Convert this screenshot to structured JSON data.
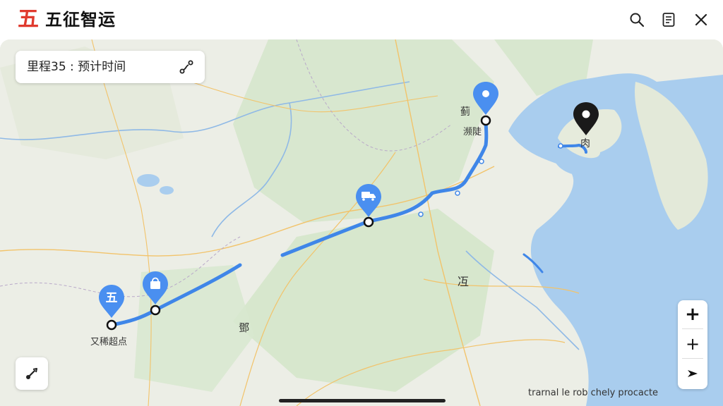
{
  "app": {
    "logo_char": "五",
    "title": "五征智运"
  },
  "header": {
    "icons": [
      "search-icon",
      "document-icon",
      "close-icon"
    ]
  },
  "info_card": {
    "text": "里程35 : 预计时间",
    "icon": "route-icon"
  },
  "map": {
    "labels": {
      "origin": "又稀超点",
      "top_city_a": "蓟",
      "top_city_b": "濒陡",
      "destination": "肉",
      "middle": "冱",
      "south": "鄧",
      "start_marker": "五"
    },
    "attribution": "trarnal le rob chely procacte",
    "markers": [
      "start-marker",
      "shop-marker",
      "truck-marker",
      "location-pin-marker",
      "destination-pin-marker"
    ]
  },
  "controls": {
    "zoom_in": "+",
    "add": "+",
    "navigate_icon": "navigate-icon",
    "tool_icon": "route-tool-icon"
  },
  "colors": {
    "accent_red": "#e03a2e",
    "route_blue": "#3f86e8",
    "marker_blue": "#4a8ff0",
    "sea": "#a9cdee",
    "land": "#eceee6",
    "green": "#cfe2c3"
  }
}
